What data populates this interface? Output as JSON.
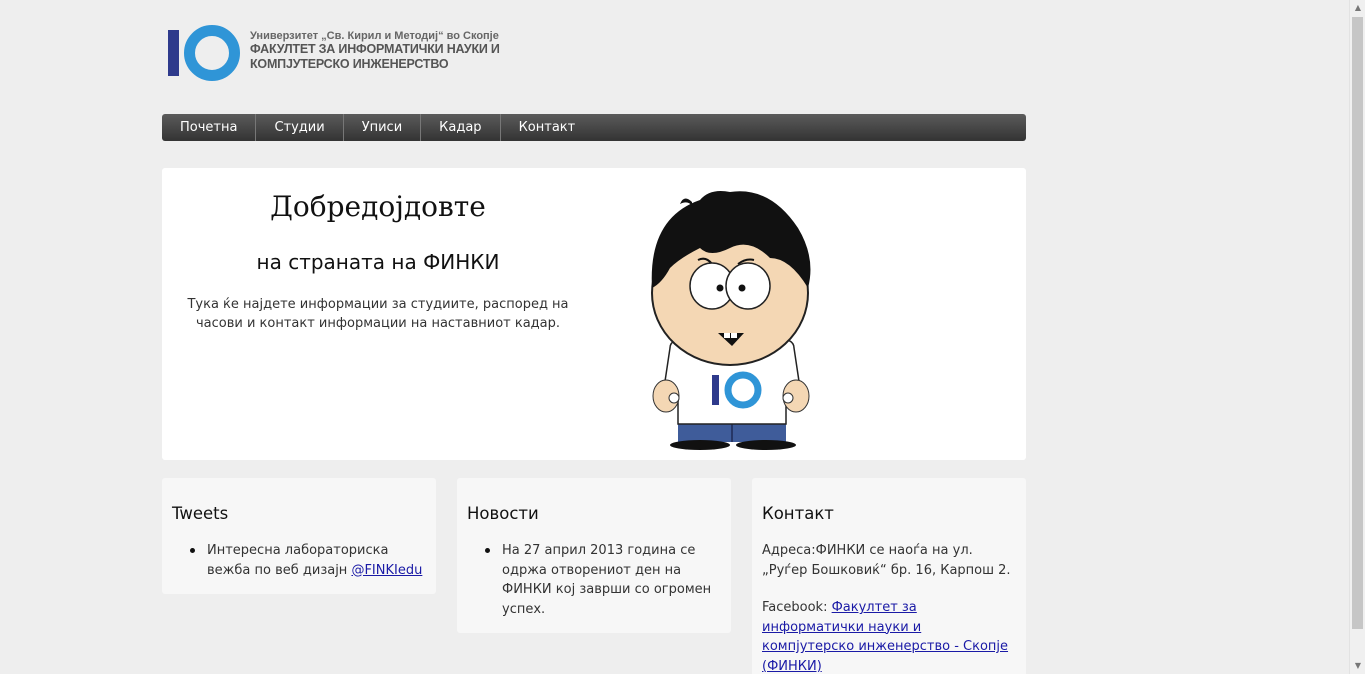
{
  "header": {
    "logo_university": "Универзитет „Св. Кирил и Методиј“ во Скопје",
    "logo_faculty_line1": "ФАКУЛТЕТ ЗА ИНФОРМАТИЧКИ НАУКИ И",
    "logo_faculty_line2": "КОМПЈУТЕРСКО ИНЖЕНЕРСТВО"
  },
  "nav": {
    "items": [
      {
        "label": "Почетна"
      },
      {
        "label": "Студии"
      },
      {
        "label": "Уписи"
      },
      {
        "label": "Кадар"
      },
      {
        "label": "Контакт"
      }
    ]
  },
  "hero": {
    "title": "Добредојдовте",
    "subtitle": "на страната на ФИНКИ",
    "description": "Тука ќе најдете информации за студиите, распоред на часови и контакт информации на наставниот кадар.",
    "mascot_icon": "mascot-illustration"
  },
  "tweets": {
    "heading": "Tweets",
    "item_text": "Интересна лабораториска вежба по веб дизајн ",
    "item_link": "@FINKIedu"
  },
  "news": {
    "heading": "Новости",
    "item_text": "На 27 април 2013 година се одржа отворениот ден на ФИНКИ кој заврши со огромен успех."
  },
  "contact": {
    "heading": "Контакт",
    "address": "Адреса:ФИНКИ се наоѓа на ул. „Руѓер Бошковиќ“ бр. 16, Карпош 2.",
    "facebook_label": "Facebook: ",
    "facebook_link": "Факултет за информатички науки и компјутерско инженерство - Скопје (ФИНКИ)"
  },
  "colors": {
    "accent_blue": "#2f95d7",
    "logo_navy": "#2e3a8c",
    "nav_dark": "#444444",
    "link": "#1a1aa6"
  }
}
